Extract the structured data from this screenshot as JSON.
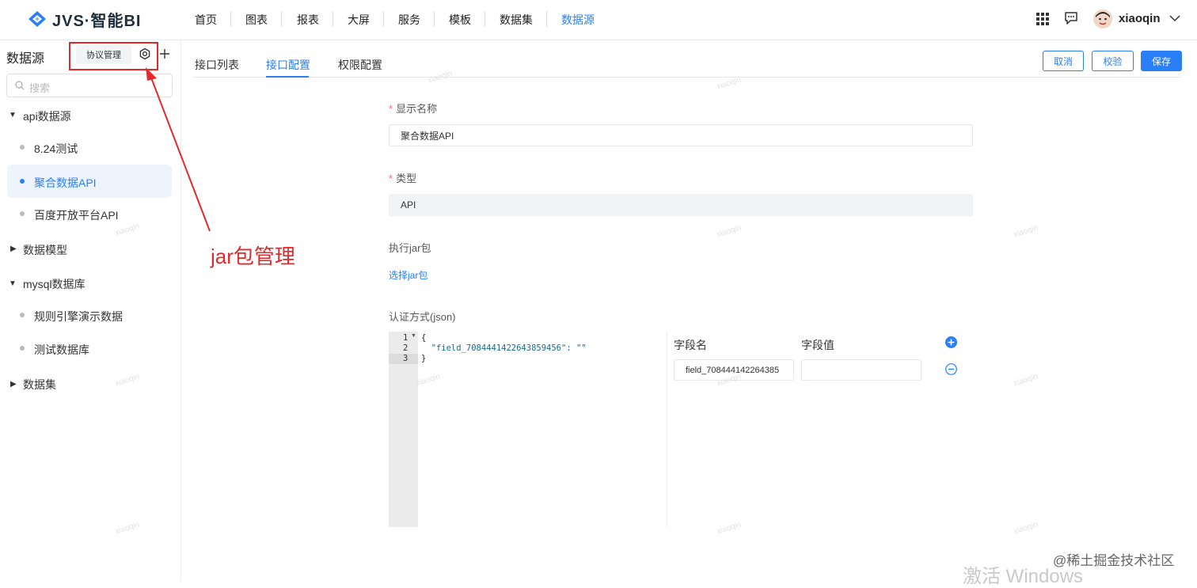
{
  "app": {
    "logo_text": "JVS·智能BI"
  },
  "nav": {
    "items": [
      "首页",
      "图表",
      "报表",
      "大屏",
      "服务",
      "模板",
      "数据集",
      "数据源"
    ],
    "active": "数据源"
  },
  "user": {
    "name": "xiaoqin"
  },
  "sidebar": {
    "title": "数据源",
    "protocol_btn": "协议管理",
    "search_placeholder": "搜索",
    "tree": [
      {
        "label": "api数据源",
        "expanded": true
      },
      {
        "label": "8.24测试"
      },
      {
        "label": "聚合数据API",
        "selected": true
      },
      {
        "label": "百度开放平台API"
      },
      {
        "label": "数据模型",
        "expanded": false
      },
      {
        "label": "mysql数据库",
        "expanded": true
      },
      {
        "label": "规则引擎演示数据"
      },
      {
        "label": "测试数据库"
      },
      {
        "label": "数据集",
        "expanded": false
      }
    ]
  },
  "annotation": {
    "text": "jar包管理",
    "color": "#e5282c"
  },
  "tabs": [
    "接口列表",
    "接口配置",
    "权限配置"
  ],
  "active_tab": "接口配置",
  "actions": {
    "cancel": "取消",
    "validate": "校验",
    "save": "保存"
  },
  "form": {
    "display_name_label": "显示名称",
    "display_name_value": "聚合数据API",
    "type_label": "类型",
    "type_value": "API",
    "jar_label": "执行jar包",
    "jar_link": "选择jar包",
    "auth_label": "认证方式(json)",
    "code_line_numbers": [
      "1",
      "2",
      "3"
    ],
    "code_lines": [
      "{",
      "  \"field_7084441422643859456\": \"\"",
      "}"
    ],
    "field_name_header": "字段名",
    "field_value_header": "字段值",
    "field_row_name": "field_708444142264385",
    "field_row_value": ""
  },
  "watermark_text": "xiaoqin",
  "footer": {
    "credit": "@稀土掘金技术社区",
    "activation": "激活 Windows"
  },
  "colors": {
    "accent": "#2a7ff7",
    "required": "#f56c6c"
  }
}
